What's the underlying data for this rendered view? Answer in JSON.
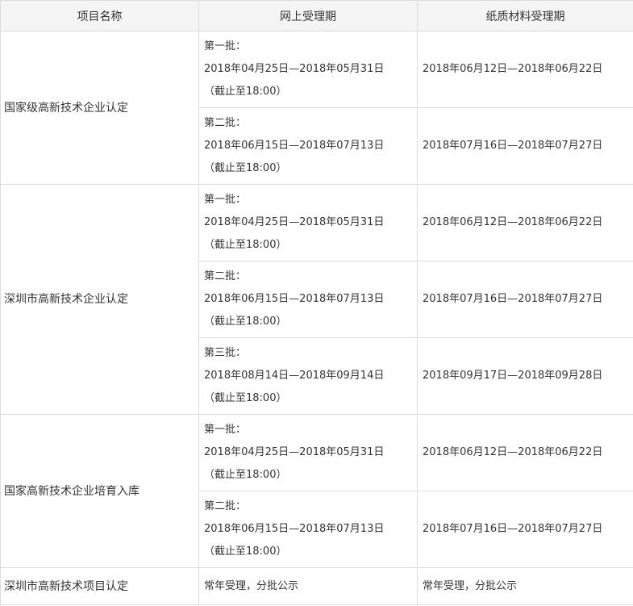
{
  "header": {
    "col_name": "项目名称",
    "col_online": "网上受理期",
    "col_paper": "纸质材料受理期"
  },
  "projects": [
    {
      "name": "国家级高新技术企业认定",
      "batches": [
        {
          "label": "第一批：",
          "online": "2018年04月25日—2018年05月31日",
          "deadline": "（截止至18:00）",
          "paper": "2018年06月12日—2018年06月22日"
        },
        {
          "label": "第二批：",
          "online": "2018年06月15日—2018年07月13日",
          "deadline": "（截止至18:00）",
          "paper": "2018年07月16日—2018年07月27日"
        }
      ]
    },
    {
      "name": "深圳市高新技术企业认定",
      "batches": [
        {
          "label": "第一批：",
          "online": "2018年04月25日—2018年05月31日",
          "deadline": "（截止至18:00）",
          "paper": "2018年06月12日—2018年06月22日"
        },
        {
          "label": "第二批：",
          "online": "2018年06月15日—2018年07月13日",
          "deadline": "（截止至18:00）",
          "paper": "2018年07月16日—2018年07月27日"
        },
        {
          "label": "第三批：",
          "online": "2018年08月14日—2018年09月14日",
          "deadline": "（截止至18:00）",
          "paper": "2018年09月17日—2018年09月28日"
        }
      ]
    },
    {
      "name": "国家高新技术企业培育入库",
      "batches": [
        {
          "label": "第一批：",
          "online": "2018年04月25日—2018年05月31日",
          "deadline": "（截止至18:00）",
          "paper": "2018年06月12日—2018年06月22日"
        },
        {
          "label": "第二批：",
          "online": "2018年06月15日—2018年07月13日",
          "deadline": "（截止至18:00）",
          "paper": "2018年07月16日—2018年07月27日"
        }
      ]
    },
    {
      "name": "深圳市高新技术项目认定",
      "online_text": "常年受理，分批公示",
      "paper_text": "常年受理，分批公示"
    }
  ]
}
